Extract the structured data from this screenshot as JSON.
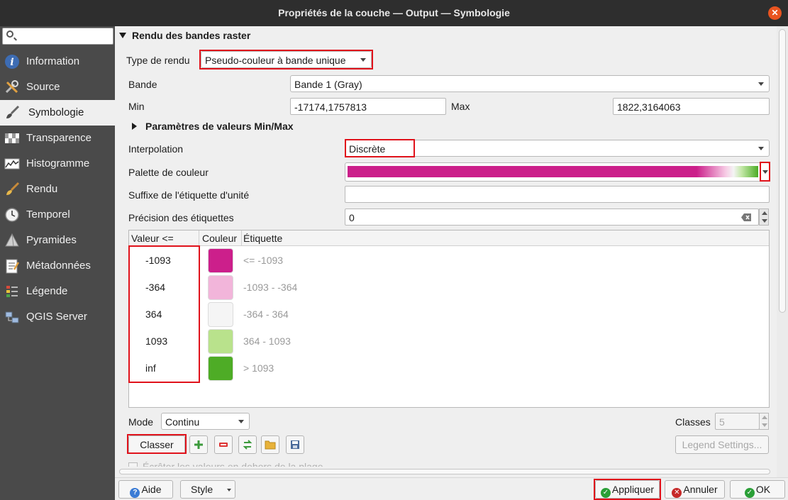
{
  "window": {
    "title": "Propriétés de la couche — Output — Symbologie"
  },
  "sidebar": {
    "search_placeholder": "",
    "items": [
      {
        "label": "Information",
        "icon": "info-icon"
      },
      {
        "label": "Source",
        "icon": "source-tools-icon"
      },
      {
        "label": "Symbologie",
        "icon": "paintbrush-icon",
        "active": true
      },
      {
        "label": "Transparence",
        "icon": "transparency-icon"
      },
      {
        "label": "Histogramme",
        "icon": "histogram-icon"
      },
      {
        "label": "Rendu",
        "icon": "rendering-brush-icon"
      },
      {
        "label": "Temporel",
        "icon": "clock-icon"
      },
      {
        "label": "Pyramides",
        "icon": "pyramid-icon"
      },
      {
        "label": "Métadonnées",
        "icon": "metadata-icon"
      },
      {
        "label": "Légende",
        "icon": "legend-icon"
      },
      {
        "label": "QGIS Server",
        "icon": "server-icon"
      }
    ]
  },
  "render": {
    "section_title": "Rendu des bandes raster",
    "type_label": "Type de rendu",
    "type_value": "Pseudo-couleur à bande unique",
    "band_label": "Bande",
    "band_value": "Bande 1 (Gray)",
    "min_label": "Min",
    "min_value": "-17174,1757813",
    "max_label": "Max",
    "max_value": "1822,3164063",
    "minmax_section": "Paramètres de valeurs Min/Max",
    "interp_label": "Interpolation",
    "interp_value": "Discrète",
    "palette_label": "Palette de couleur",
    "suffix_label": "Suffixe de l'étiquette d'unité",
    "suffix_value": "",
    "precision_label": "Précision des étiquettes",
    "precision_value": "0"
  },
  "table": {
    "headers": [
      "Valeur <=",
      "Couleur",
      "Étiquette"
    ],
    "rows": [
      {
        "value": "-1093",
        "color": "#cc1f8b",
        "label": "<= -1093"
      },
      {
        "value": "-364",
        "color": "#f2b5da",
        "label": "-1093 - -364"
      },
      {
        "value": "364",
        "color": "#f5f5f5",
        "label": "-364 - 364"
      },
      {
        "value": "1093",
        "color": "#b9e28c",
        "label": "364 - 1093"
      },
      {
        "value": "inf",
        "color": "#4eac26",
        "label": "> 1093"
      }
    ]
  },
  "controls": {
    "mode_label": "Mode",
    "mode_value": "Continu",
    "classes_label": "Classes",
    "classes_value": "5",
    "classify_label": "Classer",
    "legend_settings_label": "Legend Settings...",
    "clip_label": "Écrêter les valeurs en dehors de la plage"
  },
  "footer": {
    "help_label": "Aide",
    "style_label": "Style",
    "apply_label": "Appliquer",
    "cancel_label": "Annuler",
    "ok_label": "OK"
  },
  "colors": {
    "accent_red": "#e0121b",
    "ok_green": "#2b9f37",
    "cancel_red": "#c62828"
  }
}
